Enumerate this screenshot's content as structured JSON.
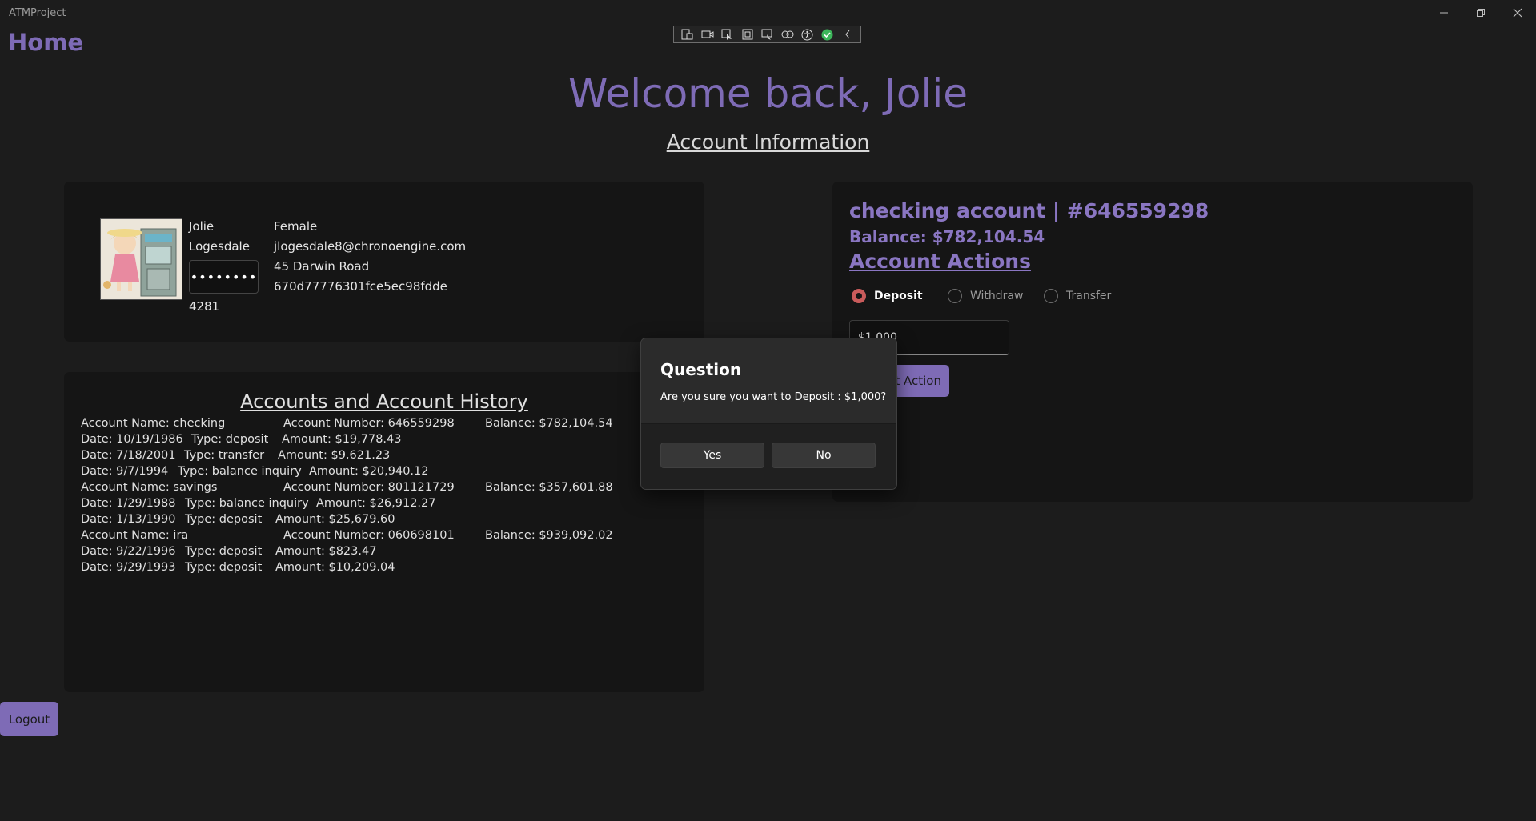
{
  "window": {
    "title": "ATMProject",
    "minimize_icon": "minimize-icon",
    "restore_icon": "restore-icon",
    "close_icon": "close-icon"
  },
  "page": {
    "home_label": "Home",
    "welcome": "Welcome back, Jolie",
    "account_info_heading": "Account Information"
  },
  "debug_toolbar": {
    "icons": [
      "live-visual-tree-icon",
      "video-icon",
      "select-element-icon",
      "display-layout-adorners-icon",
      "track-focus-icon",
      "binding-failures-icon",
      "accessibility-checker-icon",
      "check-circle-icon",
      "collapse-chevron-icon"
    ]
  },
  "profile": {
    "first_name": "Jolie",
    "last_name": "Logesdale",
    "password_mask": "••••••••",
    "pin": "4281",
    "gender": "Female",
    "email": "jlogesdale8@chronoengine.com",
    "address": "45 Darwin Road",
    "user_id": "670d77776301fce5ec98fdde"
  },
  "history": {
    "heading": "Accounts and Account History",
    "rows": [
      {
        "kind": "account",
        "c1": "Account Name: checking",
        "c2": "Account Number: 646559298",
        "c3": "Balance: $782,104.54"
      },
      {
        "kind": "txn",
        "c1": "Date: 10/19/1986",
        "c2": "Type: deposit",
        "c3": "Amount: $19,778.43"
      },
      {
        "kind": "txn",
        "c1": "Date: 7/18/2001",
        "c2": "Type: transfer",
        "c3": "Amount: $9,621.23"
      },
      {
        "kind": "txn",
        "c1": "Date: 9/7/1994",
        "c2": "Type: balance inquiry",
        "c3": "Amount: $20,940.12"
      },
      {
        "kind": "account",
        "c1": "Account Name: savings",
        "c2": "Account Number: 801121729",
        "c3": "Balance: $357,601.88"
      },
      {
        "kind": "txn",
        "c1": "Date: 1/29/1988",
        "c2": "Type: balance inquiry",
        "c3": "Amount: $26,912.27"
      },
      {
        "kind": "txn",
        "c1": "Date: 1/13/1990",
        "c2": "Type: deposit",
        "c3": "Amount: $25,679.60"
      },
      {
        "kind": "account",
        "c1": "Account Name: ira",
        "c2": "Account Number: 060698101",
        "c3": "Balance: $939,092.02"
      },
      {
        "kind": "txn",
        "c1": "Date: 9/22/1996",
        "c2": "Type: deposit",
        "c3": "Amount: $823.47"
      },
      {
        "kind": "txn",
        "c1": "Date: 9/29/1993",
        "c2": "Type: deposit",
        "c3": "Amount: $10,209.04"
      }
    ]
  },
  "account_panel": {
    "title": "checking account | #646559298",
    "balance": "Balance: $782,104.54",
    "actions_heading": "Account Actions",
    "options": [
      "Deposit",
      "Withdraw",
      "Transfer"
    ],
    "selected_option": "Deposit",
    "amount_value": "$1,000",
    "submit_label": "Submit Action"
  },
  "logout_label": "Logout",
  "dialog": {
    "title": "Question",
    "message": "Are you sure you want to Deposit : $1,000?",
    "yes_label": "Yes",
    "no_label": "No"
  },
  "colors": {
    "accent": "#7e6bb6",
    "background": "#1c1c1c",
    "card": "#151515",
    "radio_selected": "#c95b5b"
  }
}
